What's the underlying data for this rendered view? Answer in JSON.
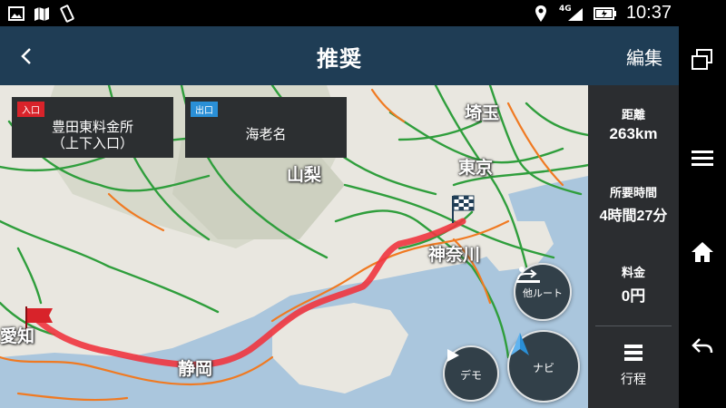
{
  "status": {
    "network": "4G",
    "time": "10:37"
  },
  "header": {
    "title": "推奨",
    "edit_label": "編集"
  },
  "entrance": {
    "tag": "入口",
    "name_line1": "豊田東料金所",
    "name_line2": "（上下入口）",
    "tag_color": "#d8232a"
  },
  "exit": {
    "tag": "出口",
    "name": "海老名",
    "tag_color": "#2a8fd6"
  },
  "map_labels": {
    "saitama": "埼玉",
    "yamanashi": "山梨",
    "tokyo": "東京",
    "kanagawa": "神奈川",
    "shizuoka": "静岡",
    "aichi": "愛知"
  },
  "buttons": {
    "alt_route": "他ルート",
    "demo": "デモ",
    "navi": "ナビ"
  },
  "info": {
    "distance_label": "距離",
    "distance_value": "263km",
    "time_label": "所要時間",
    "time_value": "4時間27分",
    "fee_label": "料金",
    "fee_value": "0円",
    "itinerary_label": "行程"
  },
  "colors": {
    "header_bg": "#1f3d55",
    "route": "#f0353f",
    "road_green": "#2f9e3c",
    "road_orange": "#f07a22",
    "water": "#a9c7de"
  },
  "icons": {
    "back": "chevron-left-icon",
    "alt_route": "alt-route-icon",
    "demo": "play-icon",
    "navi": "navigation-arrow-icon",
    "itinerary": "list-icon",
    "goal": "checkered-flag-icon",
    "start": "red-flag-icon"
  }
}
